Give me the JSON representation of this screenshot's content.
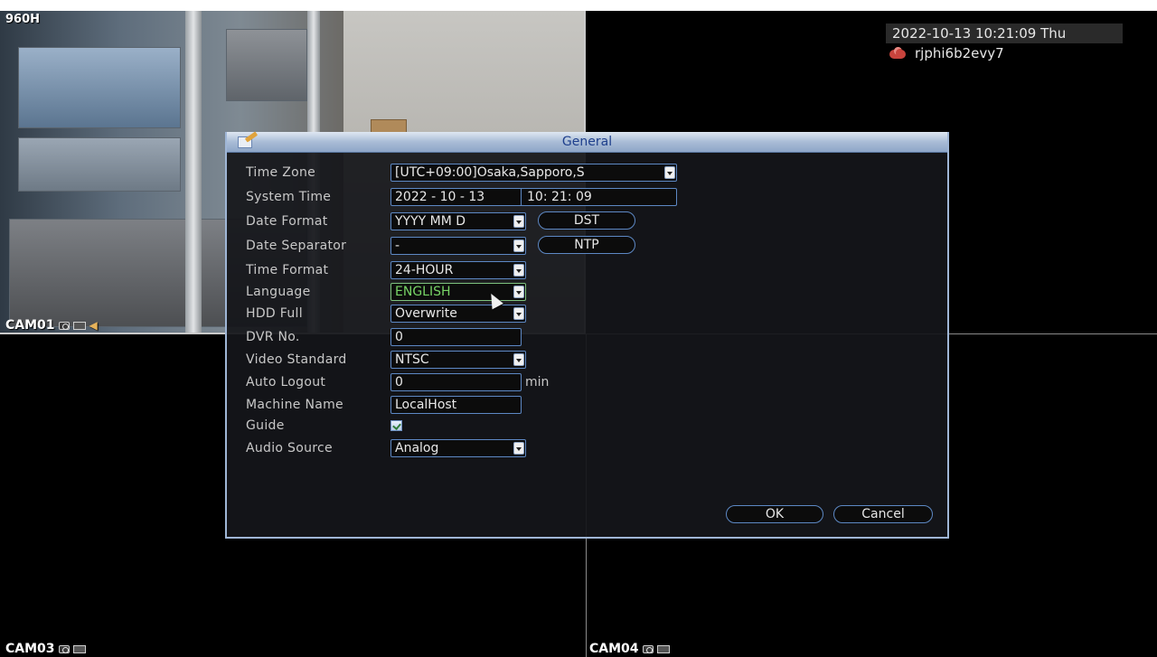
{
  "overlay": {
    "resolution_label": "960H",
    "datetime": "2022-10-13 10:21:09 Thu",
    "device_id": "rjphi6b2evy7",
    "device_icon": "cloud-icon"
  },
  "cameras": {
    "cam01": "CAM01",
    "cam03": "CAM03",
    "cam04": "CAM04"
  },
  "dialog": {
    "title": "General",
    "fields": {
      "time_zone": {
        "label": "Time Zone",
        "value": "[UTC+09:00]Osaka,Sapporo,S"
      },
      "system_time": {
        "label": "System Time",
        "date": "2022 - 10 - 13",
        "time": "10: 21: 09"
      },
      "date_format": {
        "label": "Date Format",
        "value": "YYYY MM D"
      },
      "date_separator": {
        "label": "Date Separator",
        "value": "-"
      },
      "time_format": {
        "label": "Time Format",
        "value": "24-HOUR"
      },
      "language": {
        "label": "Language",
        "value": "ENGLISH"
      },
      "hdd_full": {
        "label": "HDD Full",
        "value": "Overwrite"
      },
      "dvr_no": {
        "label": "DVR No.",
        "value": "0"
      },
      "video_standard": {
        "label": "Video Standard",
        "value": "NTSC"
      },
      "auto_logout": {
        "label": "Auto Logout",
        "value": "0",
        "unit": "min"
      },
      "machine_name": {
        "label": "Machine Name",
        "value": "LocalHost"
      },
      "guide": {
        "label": "Guide",
        "checked": true
      },
      "audio_source": {
        "label": "Audio Source",
        "value": "Analog"
      }
    },
    "buttons": {
      "dst": "DST",
      "ntp": "NTP",
      "ok": "OK",
      "cancel": "Cancel"
    }
  },
  "colors": {
    "field_border": "#5d88c4",
    "focused_text": "#77d466",
    "title_text": "#1e3f8c"
  }
}
